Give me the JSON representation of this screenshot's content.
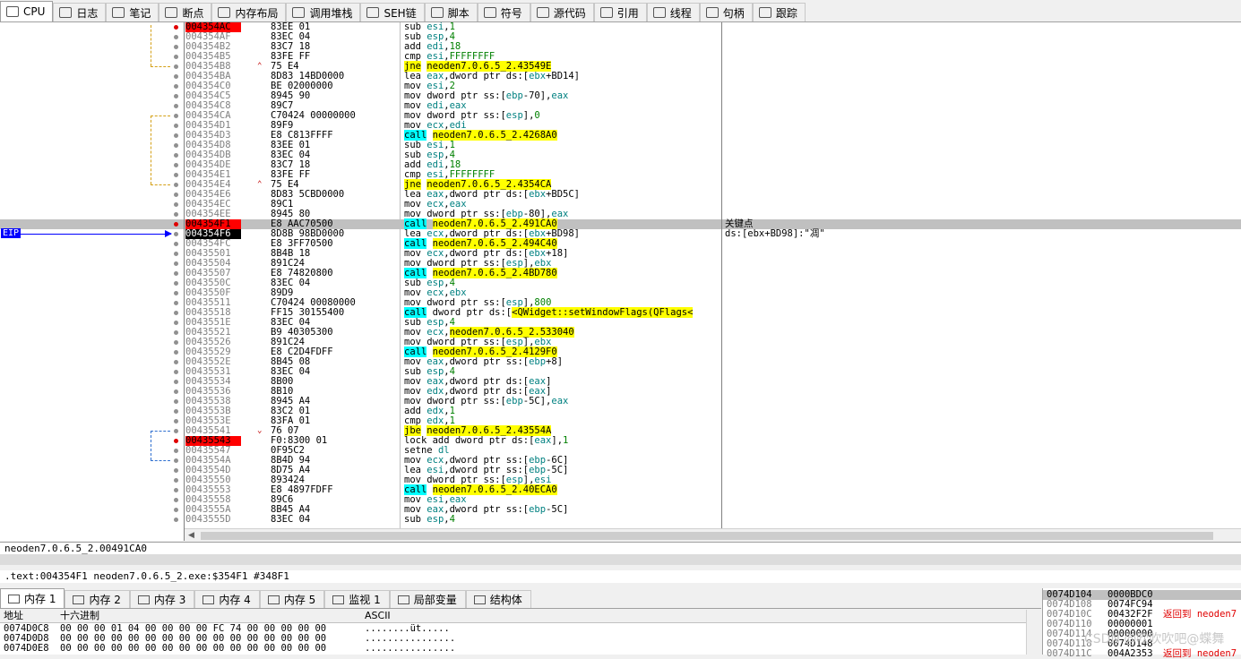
{
  "top_tabs": [
    {
      "label": "CPU",
      "icon": "cpu-icon",
      "active": true
    },
    {
      "label": "日志",
      "icon": "log-icon"
    },
    {
      "label": "笔记",
      "icon": "notes-icon"
    },
    {
      "label": "断点",
      "icon": "breakpoint-icon"
    },
    {
      "label": "内存布局",
      "icon": "memory-map-icon"
    },
    {
      "label": "调用堆栈",
      "icon": "call-stack-icon"
    },
    {
      "label": "SEH链",
      "icon": "seh-icon"
    },
    {
      "label": "脚本",
      "icon": "script-icon"
    },
    {
      "label": "符号",
      "icon": "symbols-icon"
    },
    {
      "label": "源代码",
      "icon": "source-icon"
    },
    {
      "label": "引用",
      "icon": "references-icon"
    },
    {
      "label": "线程",
      "icon": "threads-icon"
    },
    {
      "label": "句柄",
      "icon": "handles-icon"
    },
    {
      "label": "跟踪",
      "icon": "trace-icon"
    }
  ],
  "eip_label": "EIP",
  "disasm": [
    {
      "addr": "004354AC",
      "bytes": "83EE 01",
      "instr": "sub esi,1",
      "bp": true
    },
    {
      "addr": "004354AF",
      "bytes": "83EC 04",
      "instr": "sub esp,4"
    },
    {
      "addr": "004354B2",
      "bytes": "83C7 18",
      "instr": "add edi,18"
    },
    {
      "addr": "004354B5",
      "bytes": "83FE FF",
      "instr": "cmp esi,FFFFFFFF"
    },
    {
      "addr": "004354B8",
      "bytes": "75 E4",
      "instr": "jne neoden7.0.6.5_2.43549E",
      "mark": "^",
      "kind": "jmp"
    },
    {
      "addr": "004354BA",
      "bytes": "8D83 14BD0000",
      "instr": "lea eax,dword ptr ds:[ebx+BD14]"
    },
    {
      "addr": "004354C0",
      "bytes": "BE 02000000",
      "instr": "mov esi,2"
    },
    {
      "addr": "004354C5",
      "bytes": "8945 90",
      "instr": "mov dword ptr ss:[ebp-70],eax"
    },
    {
      "addr": "004354C8",
      "bytes": "89C7",
      "instr": "mov edi,eax"
    },
    {
      "addr": "004354CA",
      "bytes": "C70424 00000000",
      "instr": "mov dword ptr ss:[esp],0"
    },
    {
      "addr": "004354D1",
      "bytes": "89F9",
      "instr": "mov ecx,edi"
    },
    {
      "addr": "004354D3",
      "bytes": "E8 C813FFFF",
      "instr": "call neoden7.0.6.5_2.4268A0",
      "kind": "call"
    },
    {
      "addr": "004354D8",
      "bytes": "83EE 01",
      "instr": "sub esi,1"
    },
    {
      "addr": "004354DB",
      "bytes": "83EC 04",
      "instr": "sub esp,4"
    },
    {
      "addr": "004354DE",
      "bytes": "83C7 18",
      "instr": "add edi,18"
    },
    {
      "addr": "004354E1",
      "bytes": "83FE FF",
      "instr": "cmp esi,FFFFFFFF"
    },
    {
      "addr": "004354E4",
      "bytes": "75 E4",
      "instr": "jne neoden7.0.6.5_2.4354CA",
      "mark": "^",
      "kind": "jmp"
    },
    {
      "addr": "004354E6",
      "bytes": "8D83 5CBD0000",
      "instr": "lea eax,dword ptr ds:[ebx+BD5C]"
    },
    {
      "addr": "004354EC",
      "bytes": "89C1",
      "instr": "mov ecx,eax"
    },
    {
      "addr": "004354EE",
      "bytes": "8945 80",
      "instr": "mov dword ptr ss:[ebp-80],eax"
    },
    {
      "addr": "004354F1",
      "bytes": "E8 AAC70500",
      "instr": "call neoden7.0.6.5_2.491CA0",
      "kind": "call",
      "bp": true,
      "sel": true,
      "comment": "关键点"
    },
    {
      "addr": "004354F6",
      "bytes": "8D8B 98BD0000",
      "instr": "lea ecx,dword ptr ds:[ebx+BD98]",
      "eip": true,
      "comment": "ds:[ebx+BD98]:\"凋\""
    },
    {
      "addr": "004354FC",
      "bytes": "E8 3FF70500",
      "instr": "call neoden7.0.6.5_2.494C40",
      "kind": "call"
    },
    {
      "addr": "00435501",
      "bytes": "8B4B 18",
      "instr": "mov ecx,dword ptr ds:[ebx+18]"
    },
    {
      "addr": "00435504",
      "bytes": "891C24",
      "instr": "mov dword ptr ss:[esp],ebx"
    },
    {
      "addr": "00435507",
      "bytes": "E8 74820800",
      "instr": "call neoden7.0.6.5_2.4BD780",
      "kind": "call"
    },
    {
      "addr": "0043550C",
      "bytes": "83EC 04",
      "instr": "sub esp,4"
    },
    {
      "addr": "0043550F",
      "bytes": "89D9",
      "instr": "mov ecx,ebx"
    },
    {
      "addr": "00435511",
      "bytes": "C70424 00080000",
      "instr": "mov dword ptr ss:[esp],800"
    },
    {
      "addr": "00435518",
      "bytes": "FF15 30155400",
      "instr": "call dword ptr ds:[<QWidget::setWindowFlags(QFlags<",
      "kind": "call"
    },
    {
      "addr": "0043551E",
      "bytes": "83EC 04",
      "instr": "sub esp,4"
    },
    {
      "addr": "00435521",
      "bytes": "B9 40305300",
      "instr": "mov ecx,neoden7.0.6.5_2.533040"
    },
    {
      "addr": "00435526",
      "bytes": "891C24",
      "instr": "mov dword ptr ss:[esp],ebx"
    },
    {
      "addr": "00435529",
      "bytes": "E8 C2D4FDFF",
      "instr": "call neoden7.0.6.5_2.4129F0",
      "kind": "call"
    },
    {
      "addr": "0043552E",
      "bytes": "8B45 08",
      "instr": "mov eax,dword ptr ss:[ebp+8]"
    },
    {
      "addr": "00435531",
      "bytes": "83EC 04",
      "instr": "sub esp,4"
    },
    {
      "addr": "00435534",
      "bytes": "8B00",
      "instr": "mov eax,dword ptr ds:[eax]"
    },
    {
      "addr": "00435536",
      "bytes": "8B10",
      "instr": "mov edx,dword ptr ds:[eax]"
    },
    {
      "addr": "00435538",
      "bytes": "8945 A4",
      "instr": "mov dword ptr ss:[ebp-5C],eax"
    },
    {
      "addr": "0043553B",
      "bytes": "83C2 01",
      "instr": "add edx,1"
    },
    {
      "addr": "0043553E",
      "bytes": "83FA 01",
      "instr": "cmp edx,1"
    },
    {
      "addr": "00435541",
      "bytes": "76 07",
      "instr": "jbe neoden7.0.6.5_2.43554A",
      "mark": "v",
      "kind": "jmp"
    },
    {
      "addr": "00435543",
      "bytes": "F0:8300 01",
      "instr": "lock add dword ptr ds:[eax],1",
      "bp": true
    },
    {
      "addr": "00435547",
      "bytes": "0F95C2",
      "instr": "setne dl"
    },
    {
      "addr": "0043554A",
      "bytes": "8B4D 94",
      "instr": "mov ecx,dword ptr ss:[ebp-6C]"
    },
    {
      "addr": "0043554D",
      "bytes": "8D75 A4",
      "instr": "lea esi,dword ptr ss:[ebp-5C]"
    },
    {
      "addr": "00435550",
      "bytes": "893424",
      "instr": "mov dword ptr ss:[esp],esi"
    },
    {
      "addr": "00435553",
      "bytes": "E8 4897FDFF",
      "instr": "call neoden7.0.6.5_2.40ECA0",
      "kind": "call"
    },
    {
      "addr": "00435558",
      "bytes": "89C6",
      "instr": "mov esi,eax"
    },
    {
      "addr": "0043555A",
      "bytes": "8B45 A4",
      "instr": "mov eax,dword ptr ss:[ebp-5C]"
    },
    {
      "addr": "0043555D",
      "bytes": "83EC 04",
      "instr": "sub esp,4"
    }
  ],
  "info_line1": "neoden7.0.6.5_2.00491CA0",
  "info_line2": ".text:004354F1 neoden7.0.6.5_2.exe:$354F1 #348F1",
  "bottom_tabs": [
    {
      "label": "内存 1",
      "active": true
    },
    {
      "label": "内存 2"
    },
    {
      "label": "内存 3"
    },
    {
      "label": "内存 4"
    },
    {
      "label": "内存 5"
    },
    {
      "label": "监视 1"
    },
    {
      "label": "局部变量"
    },
    {
      "label": "结构体"
    }
  ],
  "dump": {
    "col_addr": "地址",
    "col_hex": "十六进制",
    "col_ascii": "ASCII",
    "rows": [
      {
        "addr": "0074D0C8",
        "hex": "00 00 00 01 04 00 00 00 00 FC 74 00 00 00 00 00",
        "ascii": "........üt....."
      },
      {
        "addr": "0074D0D8",
        "hex": "00 00 00 00 00 00 00 00 00 00 00 00 00 00 00 00",
        "ascii": "................"
      },
      {
        "addr": "0074D0E8",
        "hex": "00 00 00 00 00 00 00 00 00 00 00 00 00 00 00 00",
        "ascii": "................"
      }
    ]
  },
  "stack": [
    {
      "addr": "0074D104",
      "val": "0000BDC0",
      "comment": "",
      "hl": true
    },
    {
      "addr": "0074D108",
      "val": "0074FC94",
      "comment": ""
    },
    {
      "addr": "0074D10C",
      "val": "00432F2F",
      "comment": "返回到 neoden7"
    },
    {
      "addr": "0074D110",
      "val": "00000001",
      "comment": ""
    },
    {
      "addr": "0074D114",
      "val": "00000000",
      "comment": ""
    },
    {
      "addr": "0074D118",
      "val": "0074D148",
      "comment": ""
    },
    {
      "addr": "0074D11C",
      "val": "004A2353",
      "comment": "返回到 neoden7"
    }
  ],
  "watermark": "CSDN @吹吹吹吧@蝶舞"
}
